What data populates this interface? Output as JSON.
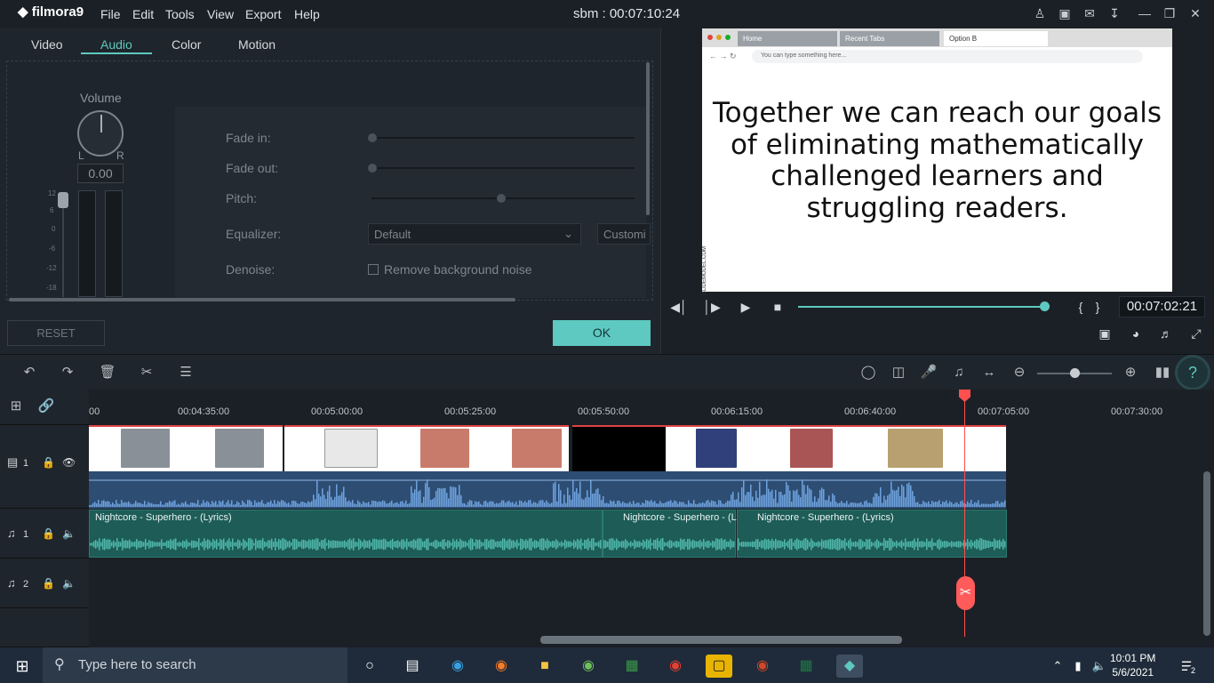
{
  "app": {
    "logo": "filmora9",
    "window_title": "sbm : 00:07:10:24"
  },
  "menu": [
    "File",
    "Edit",
    "Tools",
    "View",
    "Export",
    "Help"
  ],
  "title_icons": [
    "account-icon",
    "save-icon",
    "mail-icon",
    "download-icon",
    "minimize-icon",
    "maximize-icon",
    "close-icon"
  ],
  "tabs": [
    "Video",
    "Audio",
    "Color",
    "Motion"
  ],
  "active_tab": "Audio",
  "audio": {
    "volume_label": "Volume",
    "l": "L",
    "r": "R",
    "volume_value": "0.00",
    "db_scale": [
      "12",
      "6",
      "0",
      "-6",
      "-12",
      "-18"
    ],
    "fade_in": "Fade in:",
    "fade_out": "Fade out:",
    "pitch": "Pitch:",
    "equalizer": "Equalizer:",
    "equalizer_value": "Default",
    "customize": "Customi",
    "denoise": "Denoise:",
    "remove_noise": "Remove background noise"
  },
  "buttons": {
    "reset": "RESET",
    "ok": "OK"
  },
  "preview": {
    "browser_tabs": [
      "Home",
      "Recent Tabs",
      "Option B"
    ],
    "url_placeholder": "You can type something here...",
    "slide_text": [
      "Together we can reach our goals",
      "of eliminating mathematically",
      "challenged learners and",
      "struggling readers."
    ],
    "side_note": "SLIDEMODEL.COM",
    "timecode": "00:07:02:21",
    "progress": 0.99
  },
  "ruler_ticks": [
    "00",
    "00:04:35:00",
    "00:05:00:00",
    "00:05:25:00",
    "00:05:50:00",
    "00:06:15:00",
    "00:06:40:00",
    "00:07:05:00",
    "00:07:30:00"
  ],
  "tracks": {
    "video1": "1",
    "audio1": "1",
    "audio2": "2",
    "music_clips": [
      "Nightcore - Superhero - (Lyrics)",
      "Nightcore - Superhero - (L",
      "Nightcore - Superhero - (Lyrics)"
    ]
  },
  "taskbar": {
    "search_placeholder": "Type here to search",
    "time": "10:01 PM",
    "date": "5/6/2021",
    "notifications": "2"
  }
}
